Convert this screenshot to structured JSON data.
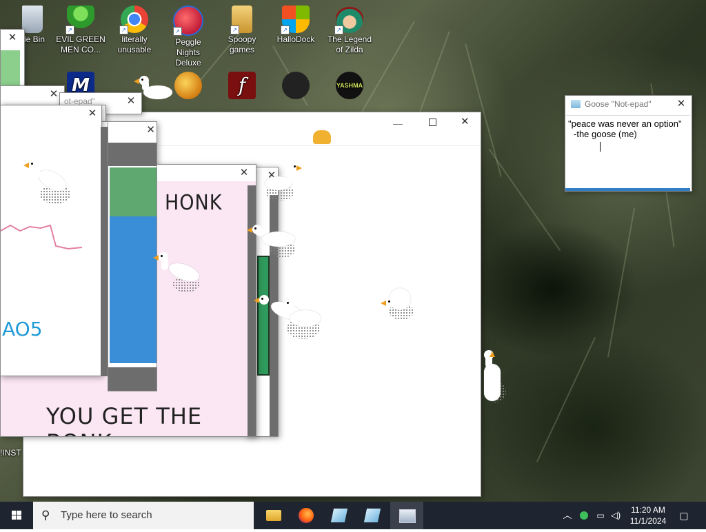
{
  "desktop": {
    "icons": [
      {
        "label": "cle Bin"
      },
      {
        "label": "EVIL GREEN MEN CO..."
      },
      {
        "label": "literally unusable"
      },
      {
        "label": "Peggle Nights Deluxe"
      },
      {
        "label": "Spoopy games"
      },
      {
        "label": "HalloDock"
      },
      {
        "label": "The Legend of Zilda"
      }
    ],
    "row2_labels": {
      "yashma": "YASHMA"
    },
    "partial_label": "!INST"
  },
  "notepad_back": {
    "title": "ot-epad\""
  },
  "notepad_front": {
    "title": "Goose \"Not-epad\"",
    "line1": "\"peace was never an option\"",
    "line2": "-the goose (me)"
  },
  "meme": {
    "top_text": "HONK",
    "bottom_text": "YOU GET THE BONK"
  },
  "drawing": {
    "scribble_text": "AO5"
  },
  "taskbar": {
    "search_placeholder": "Type here to search",
    "time": "11:20 AM",
    "date": "11/1/2024"
  },
  "colors": {
    "taskbar": "#1f2530",
    "meme_bg": "#fbe6f3",
    "goose_beak": "#f0a020",
    "water": "#3a8ed8"
  }
}
